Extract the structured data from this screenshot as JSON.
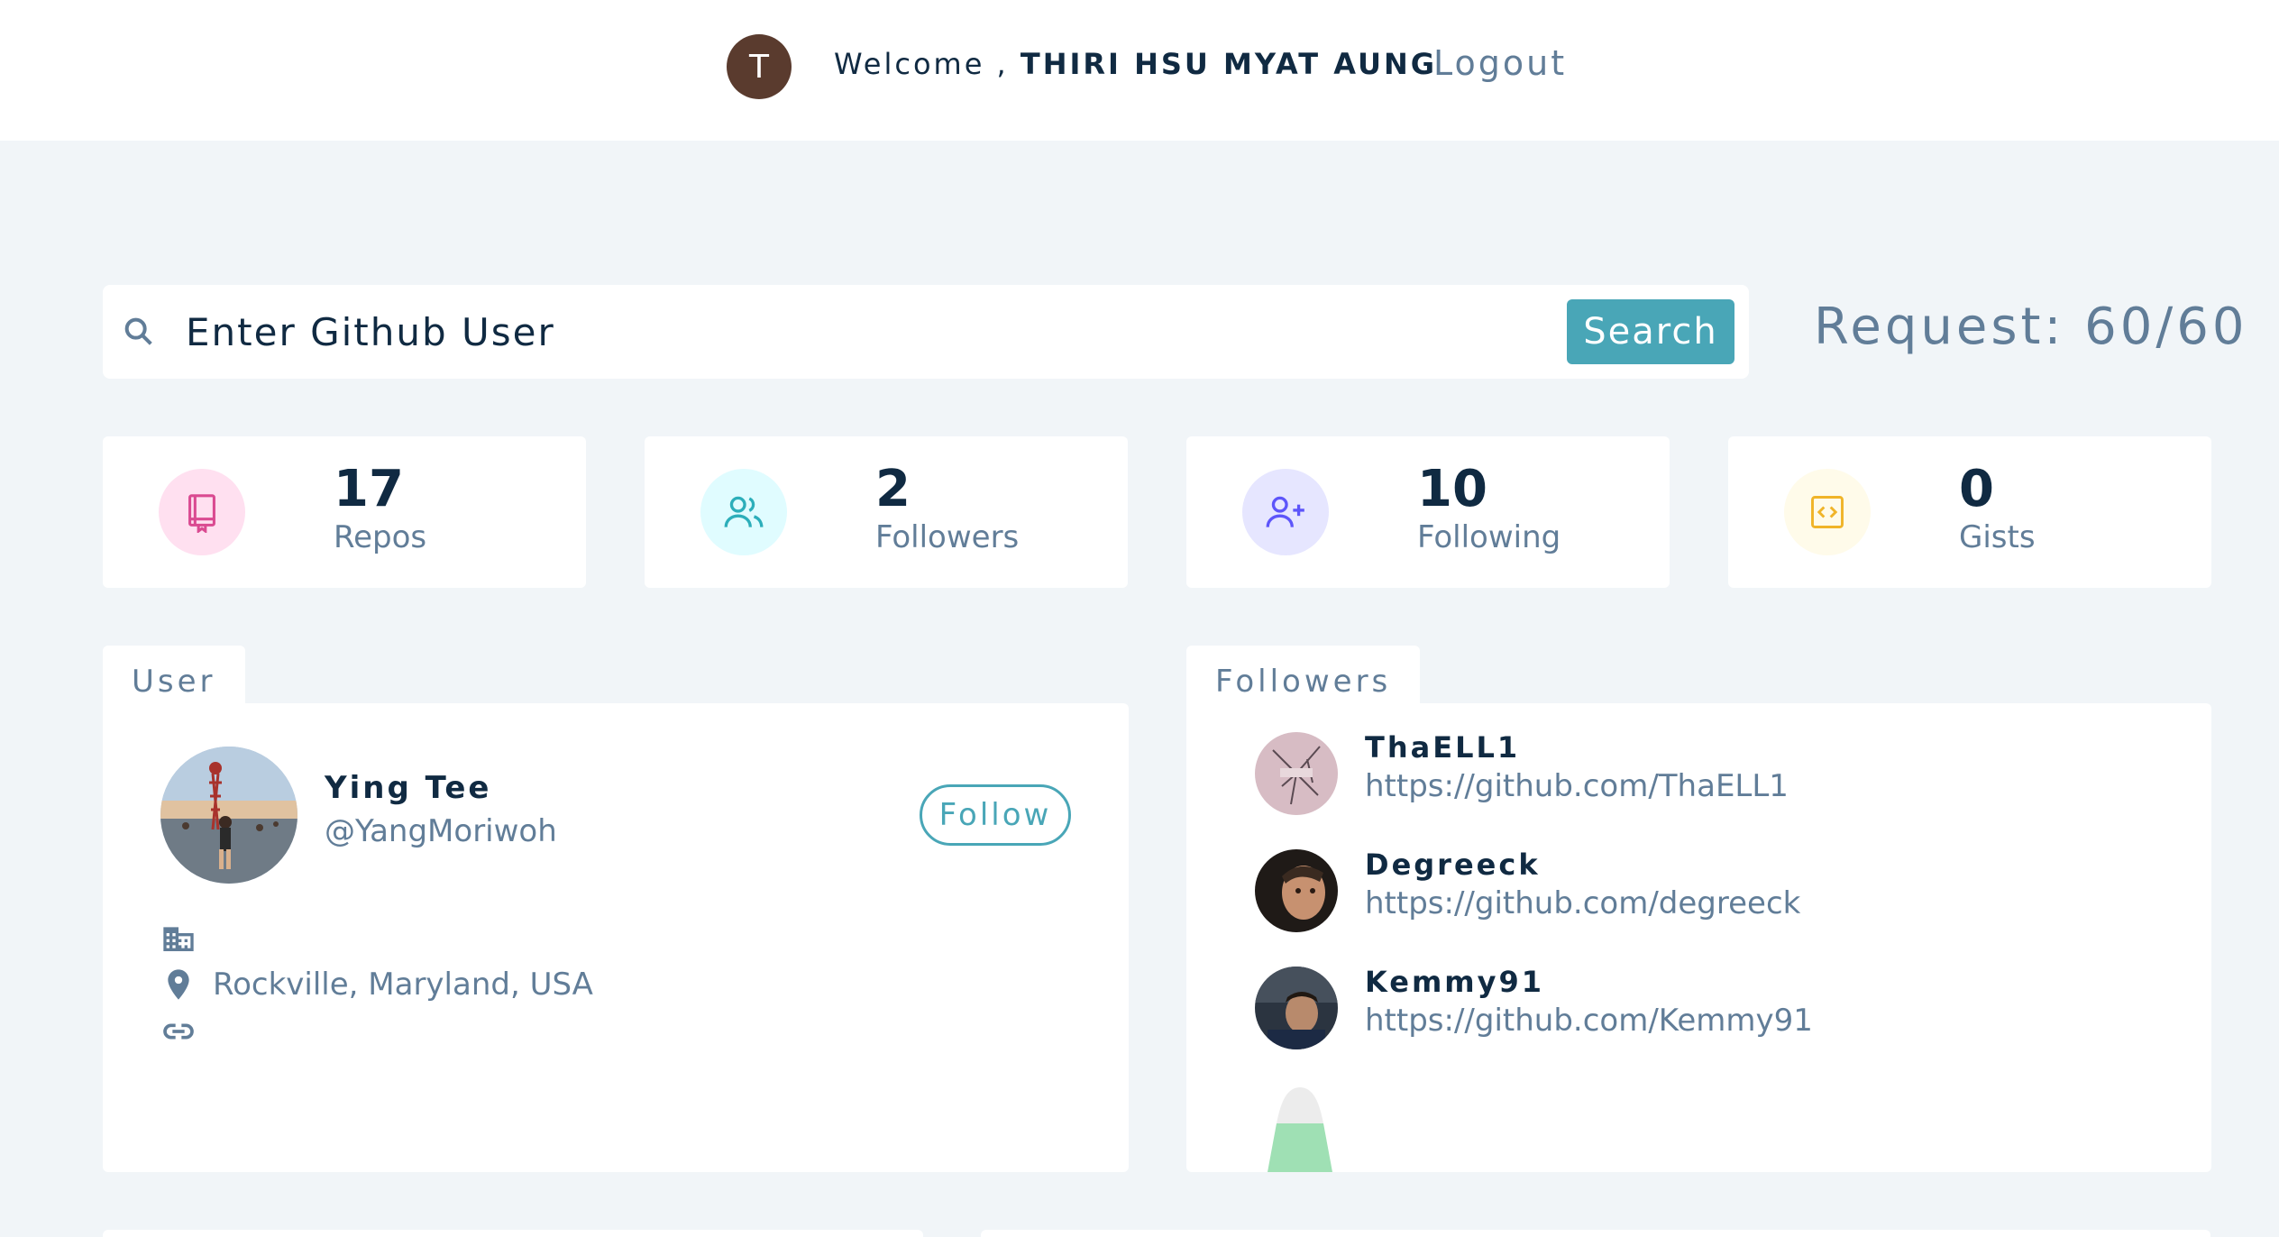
{
  "navbar": {
    "avatar_initial": "T",
    "welcome_prefix": "Welcome , ",
    "user_name": "THIRI HSU MYAT AUNG",
    "logout_label": "Logout"
  },
  "search": {
    "placeholder": "Enter Github User",
    "button_label": "Search",
    "request_text": "Request: 60/60"
  },
  "stats": [
    {
      "value": "17",
      "label": "Repos",
      "icon": "book-icon",
      "color": "#da4a91",
      "bg": "#ffe0f0"
    },
    {
      "value": "2",
      "label": "Followers",
      "icon": "users-icon",
      "color": "#2caeba",
      "bg": "#e0fcff"
    },
    {
      "value": "10",
      "label": "Following",
      "icon": "user-plus-icon",
      "color": "#5d55fa",
      "bg": "#e6e6ff"
    },
    {
      "value": "0",
      "label": "Gists",
      "icon": "code-icon",
      "color": "#f0b429",
      "bg": "#fffbea"
    }
  ],
  "user_panel": {
    "tab_label": "User",
    "name": "Ying Tee",
    "login": "@YangMoriwoh",
    "follow_label": "Follow",
    "location": "Rockville, Maryland, USA"
  },
  "followers_panel": {
    "tab_label": "Followers",
    "items": [
      {
        "name": "ThaELL1",
        "url": "https://github.com/ThaELL1"
      },
      {
        "name": "Degreeck",
        "url": "https://github.com/degreeck"
      },
      {
        "name": "Kemmy91",
        "url": "https://github.com/Kemmy91"
      }
    ]
  },
  "colors": {
    "page_bg": "#f1f5f8",
    "primary": "#49a6b7",
    "text_dark": "#102a42",
    "text_muted": "#617d98"
  }
}
